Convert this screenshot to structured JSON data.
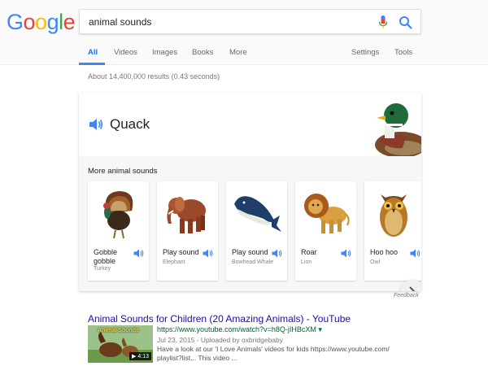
{
  "logo": {
    "letters": [
      "G",
      "o",
      "o",
      "g",
      "l",
      "e"
    ],
    "colors": [
      "#4285f4",
      "#ea4335",
      "#fbbc05",
      "#4285f4",
      "#34a853",
      "#ea4335"
    ]
  },
  "search": {
    "query": "animal sounds"
  },
  "tabs": {
    "all": "All",
    "videos": "Videos",
    "images": "Images",
    "books": "Books",
    "more": "More",
    "settings": "Settings",
    "tools": "Tools"
  },
  "stats": "About 14,400,000 results (0.43 seconds)",
  "card": {
    "current_sound": "Quack",
    "more_label": "More animal sounds",
    "animals": [
      {
        "title_line1": "Gobble",
        "title_line2": "gobble",
        "subtitle": "Turkey",
        "icon": "turkey-icon"
      },
      {
        "title_line1": "Play sound",
        "title_line2": "",
        "subtitle": "Elephant",
        "icon": "elephant-icon"
      },
      {
        "title_line1": "Play sound",
        "title_line2": "",
        "subtitle": "Bowhead Whale",
        "icon": "whale-icon"
      },
      {
        "title_line1": "Roar",
        "title_line2": "",
        "subtitle": "Lion",
        "icon": "lion-icon"
      },
      {
        "title_line1": "Hoo hoo",
        "title_line2": "",
        "subtitle": "Owl",
        "icon": "owl-icon"
      }
    ]
  },
  "feedback": "Feedback",
  "result": {
    "title": "Animal Sounds for Children (20 Amazing Animals) - YouTube",
    "url": "https://www.youtube.com/watch?v=h8Q-jIHBcXM",
    "url_caret": "▾",
    "date": "Jul 23, 2015 - Uploaded by oxbridgebaby",
    "snippet": "Have a look at our 'I Love Animals' videos for kids https://www.youtube.com/ playlist?list... This video ...",
    "thumb_label": "Animal Sounds",
    "duration": "▶ 4:13"
  },
  "colors": {
    "accent": "#4285f4",
    "link": "#1a0dab",
    "url": "#006621"
  }
}
